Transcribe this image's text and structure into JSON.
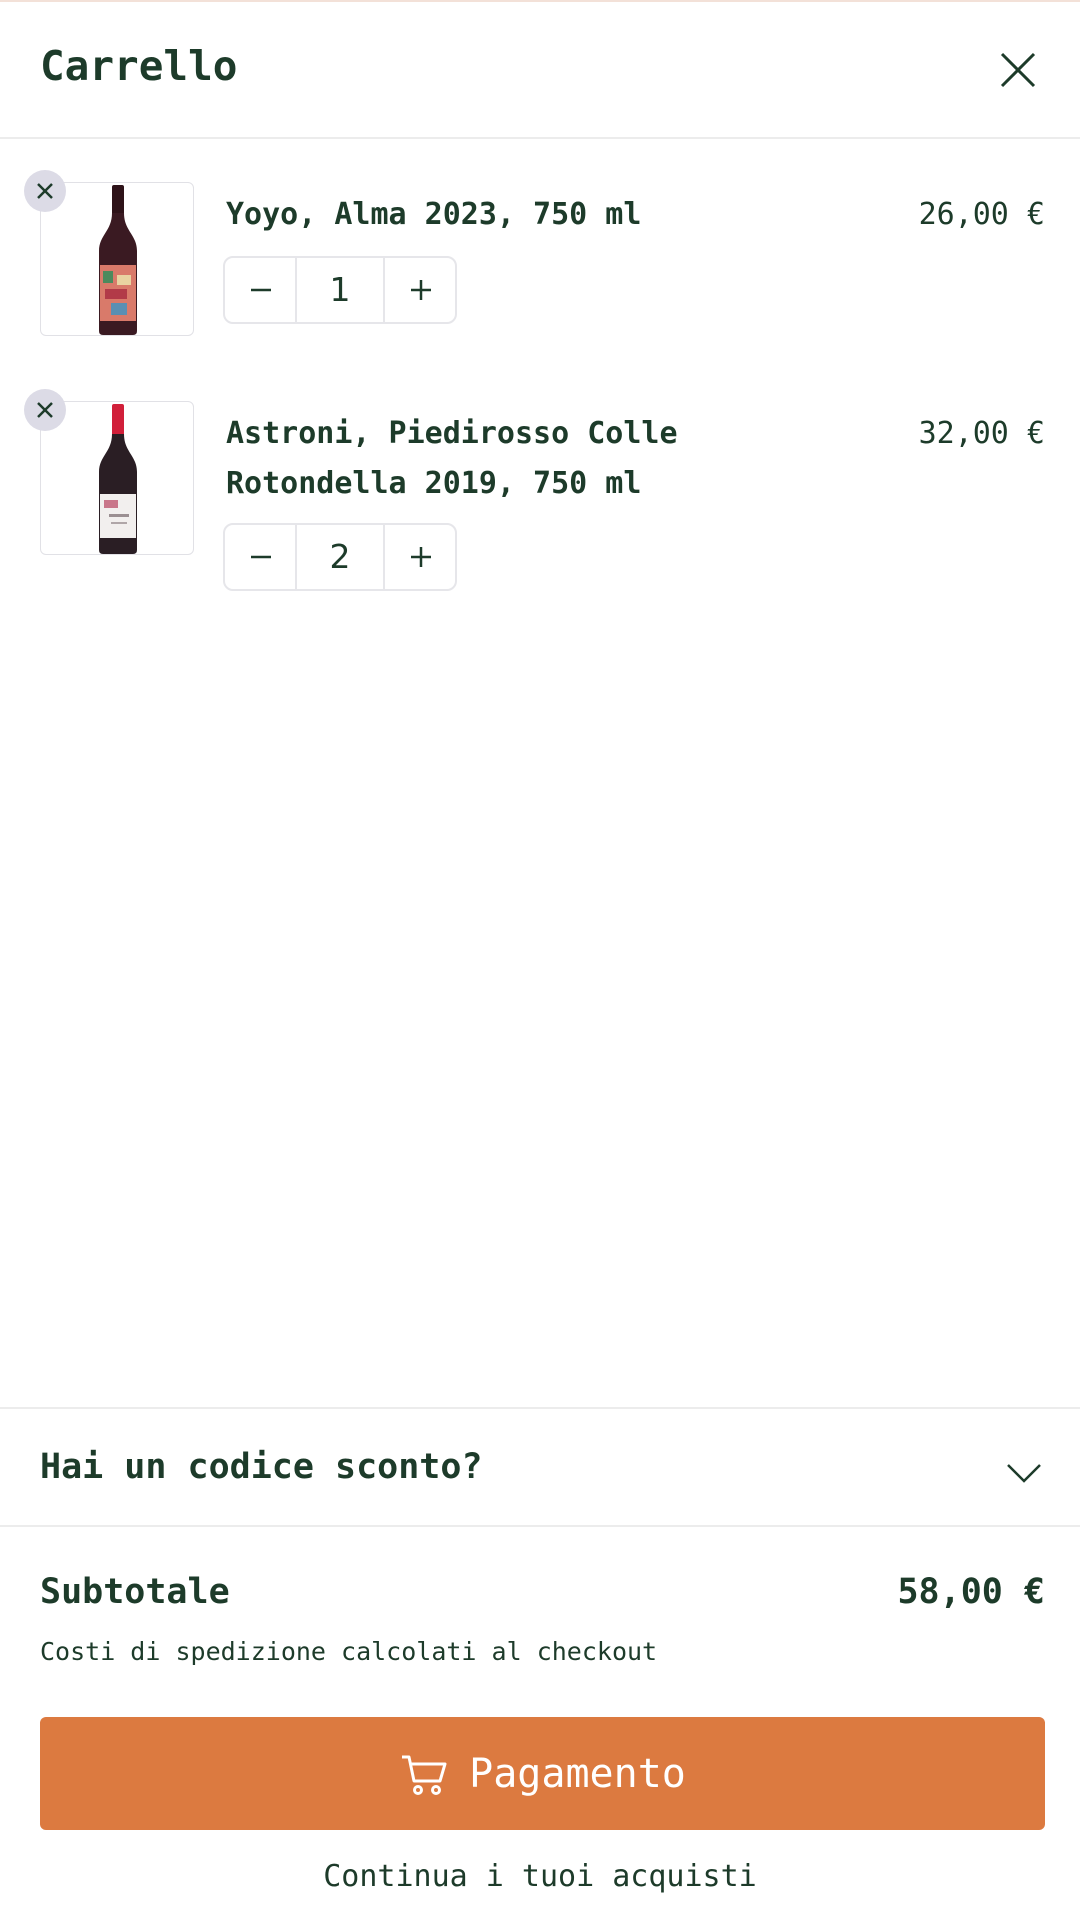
{
  "header": {
    "title": "Carrello"
  },
  "cart": {
    "items": [
      {
        "name": "Yoyo, Alma 2023, 750 ml",
        "price": "26,00 €",
        "quantity": "1",
        "capsule_color": "#3a1a22",
        "label_color": "#d97a6a"
      },
      {
        "name": "Astroni, Piedirosso Colle Rotondella 2019, 750 ml",
        "price": "32,00 €",
        "quantity": "2",
        "capsule_color": "#d11f3a",
        "label_color": "#f2efee"
      }
    ]
  },
  "discount": {
    "label": "Hai un codice sconto?"
  },
  "summary": {
    "subtotal_label": "Subtotale",
    "subtotal_value": "58,00 €",
    "shipping_note": "Costi di spedizione calcolati al checkout"
  },
  "actions": {
    "checkout_label": "Pagamento",
    "continue_label": "Continua i tuoi acquisti"
  },
  "colors": {
    "accent": "#dc7a40",
    "text": "#1d3b2a"
  }
}
